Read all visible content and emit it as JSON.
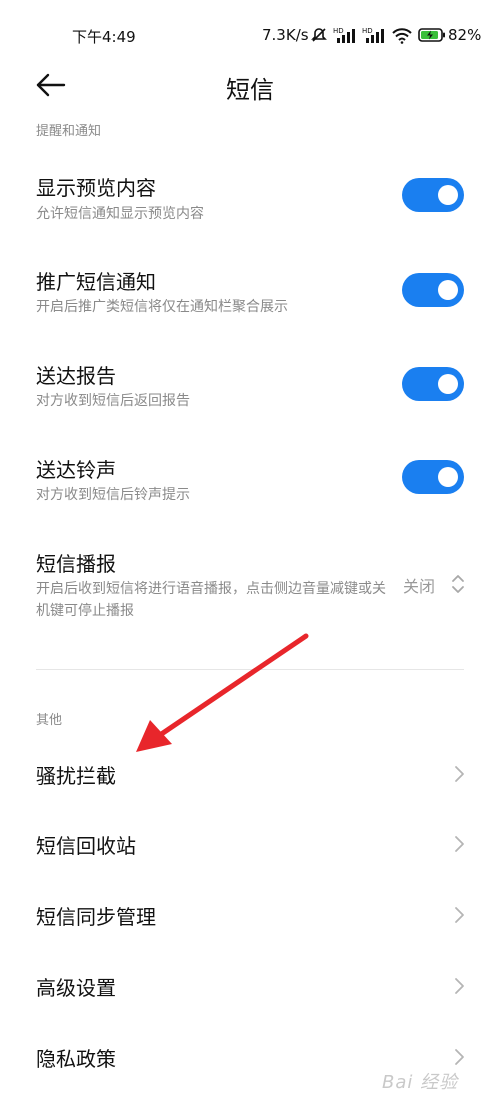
{
  "status_bar": {
    "time": "下午4:49",
    "net_speed": "7.3K/s",
    "battery_pct": "82%",
    "icons": [
      "mute-icon",
      "hd-signal-icon",
      "hd-signal-icon",
      "wifi-icon",
      "battery-charging-icon"
    ]
  },
  "header": {
    "title": "短信",
    "back_icon": "arrow-left-icon"
  },
  "sections": {
    "notify_label": "提醒和通知",
    "other_label": "其他"
  },
  "settings": [
    {
      "title": "显示预览内容",
      "subtitle": "允许短信通知显示预览内容",
      "toggle": true
    },
    {
      "title": "推广短信通知",
      "subtitle": "开启后推广类短信将仅在通知栏聚合展示",
      "toggle": true
    },
    {
      "title": "送达报告",
      "subtitle": "对方收到短信后返回报告",
      "toggle": true
    },
    {
      "title": "送达铃声",
      "subtitle": "对方收到短信后铃声提示",
      "toggle": true
    }
  ],
  "broadcast": {
    "title": "短信播报",
    "subtitle": "开启后收到短信将进行语音播报，点击侧边音量减键或关机键可停止播报",
    "value": "关闭"
  },
  "links": [
    {
      "title": "骚扰拦截"
    },
    {
      "title": "短信回收站"
    },
    {
      "title": "短信同步管理"
    },
    {
      "title": "高级设置"
    },
    {
      "title": "隐私政策"
    }
  ],
  "watermark": "Bai 经验",
  "colors": {
    "accent": "#1a7ff0",
    "annotation_arrow": "#e8262b"
  }
}
